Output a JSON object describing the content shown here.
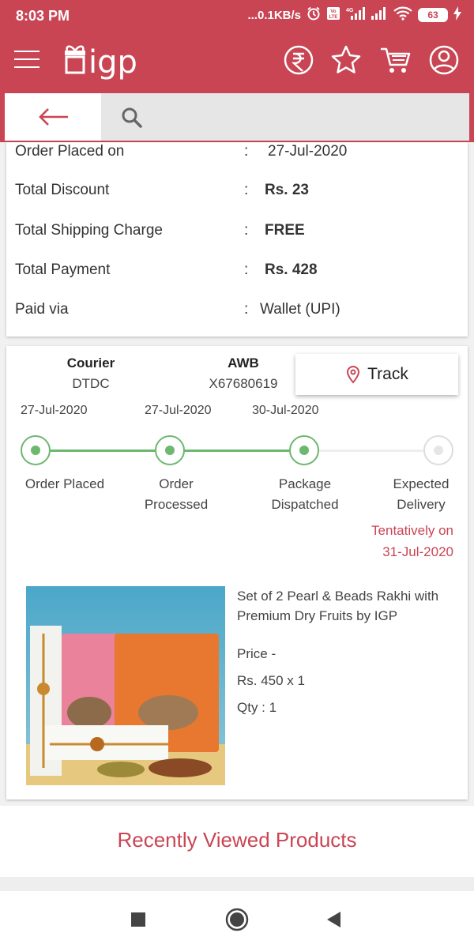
{
  "status_bar": {
    "time": "8:03 PM",
    "network_speed": "...0.1KB/s",
    "battery": "63",
    "volte": "Vo LTE",
    "net_type": "4G"
  },
  "app_bar": {
    "logo_text": "igp",
    "icons": [
      "rupee-icon",
      "star-icon",
      "cart-icon",
      "user-icon"
    ]
  },
  "search": {
    "placeholder": ""
  },
  "order_summary": {
    "rows": [
      {
        "label": "Order Placed on",
        "colon": ":",
        "value": "27-Jul-2020"
      },
      {
        "label": "Total Discount",
        "colon": ":",
        "value": "Rs. 23"
      },
      {
        "label": "Total Shipping Charge",
        "colon": ":",
        "value": "FREE"
      },
      {
        "label": "Total Payment",
        "colon": ":",
        "value": "Rs. 428"
      },
      {
        "label": "Paid via",
        "colon": ":",
        "value": "Wallet (UPI)"
      }
    ]
  },
  "shipment": {
    "courier_label": "Courier",
    "courier_value": "DTDC",
    "awb_label": "AWB",
    "awb_value": "X67680619",
    "track_label": "Track",
    "dates": [
      "27-Jul-2020",
      "27-Jul-2020",
      "30-Jul-2020"
    ],
    "stages": [
      {
        "line1": "Order Placed",
        "line2": "",
        "done": true
      },
      {
        "line1": "Order",
        "line2": "Processed",
        "done": true
      },
      {
        "line1": "Package",
        "line2": "Dispatched",
        "done": true
      },
      {
        "line1": "Expected",
        "line2": "Delivery",
        "done": false
      }
    ],
    "tentative_line1": "Tentatively on",
    "tentative_line2": "31-Jul-2020"
  },
  "product": {
    "name_line1": "Set of 2 Pearl & Beads Rakhi with",
    "name_line2": "Premium Dry Fruits by IGP",
    "price_label": "Price -",
    "price_value": "Rs. 450 x 1",
    "qty": "Qty : 1"
  },
  "recent": {
    "title": "Recently Viewed Products"
  },
  "colors": {
    "brand": "#c94554",
    "progress": "#6cb86f"
  }
}
